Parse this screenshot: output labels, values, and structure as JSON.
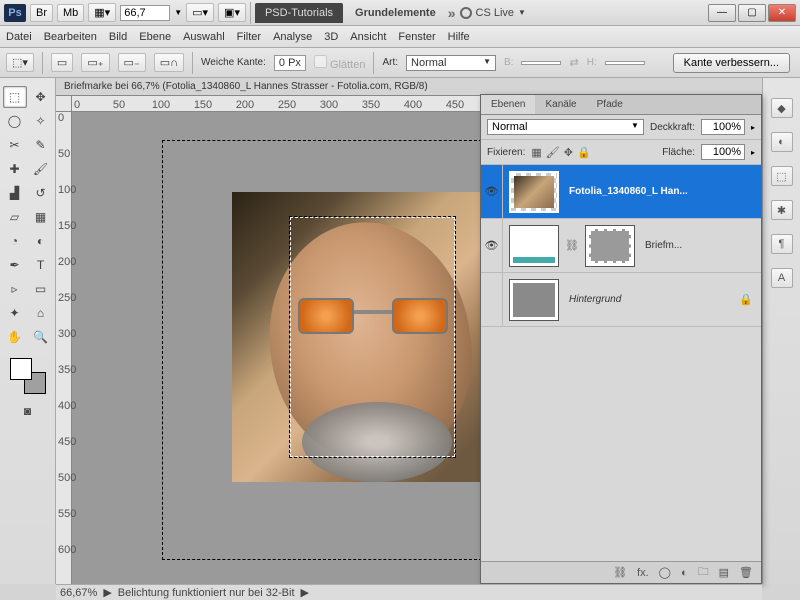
{
  "titlebar": {
    "app": "Ps",
    "br_label": "Br",
    "mb_label": "Mb",
    "zoom": "66,7",
    "tab_dark": "PSD-Tutorials",
    "tab_light": "Grundelemente",
    "cslive": "CS Live"
  },
  "menu": [
    "Datei",
    "Bearbeiten",
    "Bild",
    "Ebene",
    "Auswahl",
    "Filter",
    "Analyse",
    "3D",
    "Ansicht",
    "Fenster",
    "Hilfe"
  ],
  "options": {
    "feather_label": "Weiche Kante:",
    "feather_value": "0 Px",
    "glatten": "Glätten",
    "art_label": "Art:",
    "art_value": "Normal",
    "b_label": "B:",
    "h_label": "H:",
    "refine": "Kante verbessern..."
  },
  "document": {
    "tab": "Briefmarke bei 66,7%  (Fotolia_1340860_L Hannes Strasser - Fotolia.com, RGB/8)",
    "zoom_status": "66,67%",
    "status_text": "Belichtung funktioniert nur bei 32-Bit"
  },
  "ruler_h": [
    "0",
    "50",
    "100",
    "150",
    "200",
    "250",
    "300",
    "350",
    "400",
    "450"
  ],
  "ruler_v": [
    "0",
    "50",
    "100",
    "150",
    "200",
    "250",
    "300",
    "350",
    "400",
    "450",
    "500",
    "550",
    "600"
  ],
  "layers_panel": {
    "tabs": [
      "Ebenen",
      "Kanäle",
      "Pfade"
    ],
    "blend": "Normal",
    "opacity_label": "Deckkraft:",
    "opacity": "100%",
    "lock_label": "Fixieren:",
    "fill_label": "Fläche:",
    "fill": "100%",
    "layers": [
      {
        "name": "Fotolia_1340860_L Han...",
        "visible": true,
        "selected": true,
        "thumb": "photo"
      },
      {
        "name": "Briefm...",
        "visible": true,
        "selected": false,
        "thumb": "stamp",
        "mask": true
      },
      {
        "name": "Hintergrund",
        "visible": false,
        "selected": false,
        "thumb": "gray",
        "locked": true
      }
    ]
  }
}
